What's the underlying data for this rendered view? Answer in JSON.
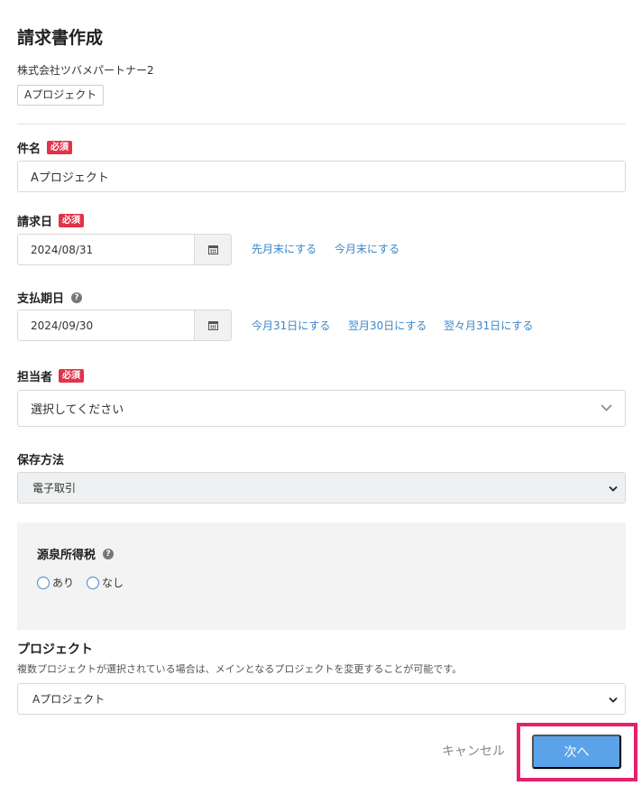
{
  "page": {
    "title": "請求書作成"
  },
  "header": {
    "company": "株式会社ツバメパートナー2",
    "project_tag": "Aプロジェクト"
  },
  "required_badge": "必須",
  "subject": {
    "label": "件名",
    "value": "Aプロジェクト"
  },
  "billing_date": {
    "label": "請求日",
    "value": "2024/08/31",
    "shortcuts": [
      "先月末にする",
      "今月末にする"
    ]
  },
  "due_date": {
    "label": "支払期日",
    "value": "2024/09/30",
    "shortcuts": [
      "今月31日にする",
      "翌月30日にする",
      "翌々月31日にする"
    ]
  },
  "assignee": {
    "label": "担当者",
    "placeholder": "選択してください"
  },
  "storage": {
    "label": "保存方法",
    "value": "電子取引"
  },
  "withholding_tax": {
    "label": "源泉所得税",
    "options": [
      "あり",
      "なし"
    ]
  },
  "project": {
    "label": "プロジェクト",
    "description": "複数プロジェクトが選択されている場合は、メインとなるプロジェクトを変更することが可能です。",
    "value": "Aプロジェクト"
  },
  "footer": {
    "cancel_label": "キャンセル",
    "next_label": "次へ"
  },
  "colors": {
    "accent": "#5aa3e8",
    "required": "#e0344b",
    "link": "#3c86c9",
    "highlight": "#e8206b"
  }
}
